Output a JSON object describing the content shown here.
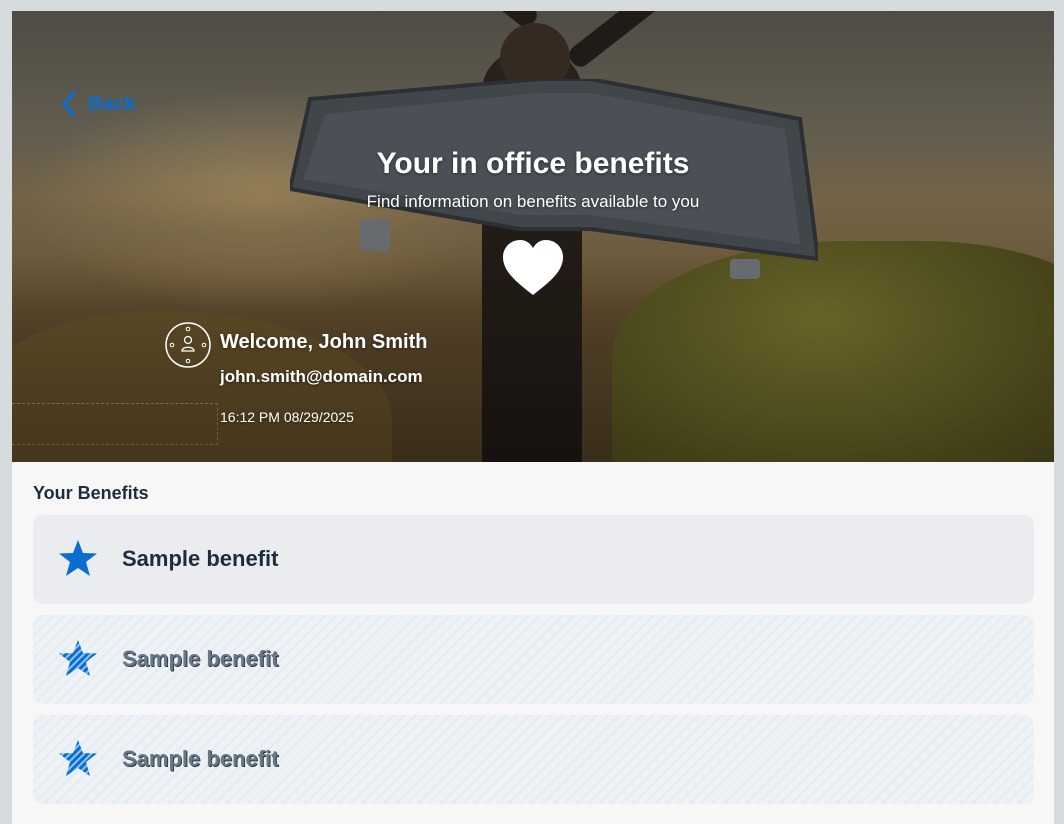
{
  "hero": {
    "back_label": "Back",
    "title": "Your in office benefits",
    "subtitle": "Find information on benefits available to you"
  },
  "profile": {
    "welcome": "Welcome, John Smith",
    "email": "john.smith@domain.com",
    "datetime": "16:12 PM 08/29/2025"
  },
  "benefits": {
    "section_title": "Your Benefits",
    "items": [
      {
        "label": "Sample benefit",
        "icon": "star-icon",
        "state": "active"
      },
      {
        "label": "Sample benefit",
        "icon": "star-icon",
        "state": "loading"
      },
      {
        "label": "Sample benefit",
        "icon": "star-icon",
        "state": "loading"
      }
    ]
  },
  "colors": {
    "accent": "#0a6ed1",
    "text": "#1d2d3e",
    "card": "#ebecef",
    "background": "#f7f7f7"
  }
}
